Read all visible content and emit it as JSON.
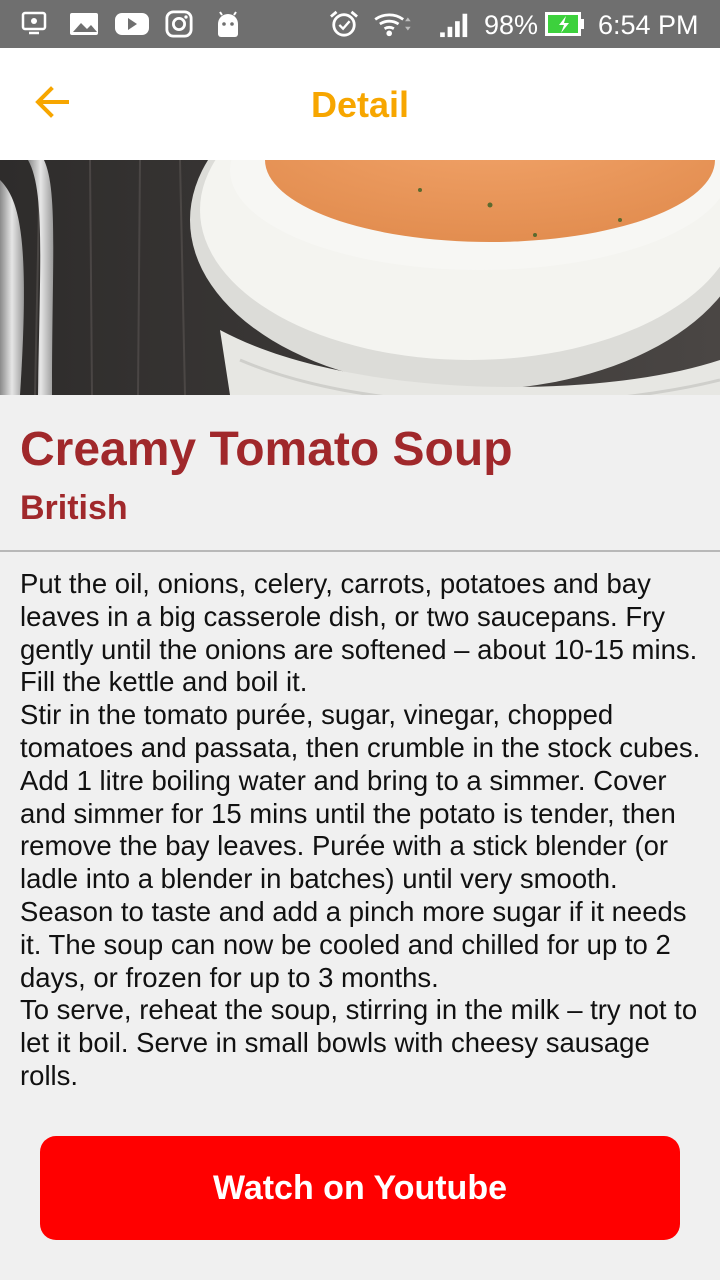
{
  "status_bar": {
    "battery": "98%",
    "time": "6:54 PM"
  },
  "app_bar": {
    "title": "Detail",
    "back_icon": "arrow-back-icon"
  },
  "recipe": {
    "name": "Creamy Tomato Soup",
    "area": "British",
    "instructions": "Put the oil, onions, celery, carrots, potatoes and bay leaves in a big casserole dish, or two saucepans. Fry gently until the onions are softened – about 10-15 mins. Fill the kettle and boil it.\nStir in the tomato purée, sugar, vinegar, chopped tomatoes and passata, then crumble in the stock cubes. Add 1 litre boiling water and bring to a simmer. Cover and simmer for 15 mins until the potato is tender, then remove the bay leaves. Purée with a stick blender (or ladle into a blender in batches) until very smooth. Season to taste and add a pinch more sugar if it needs it. The soup can now be cooled and chilled for up to 2 days, or frozen for up to 3 months.\nTo serve, reheat the soup, stirring in the milk – try not to let it boil. Serve in small bowls with cheesy sausage rolls."
  },
  "actions": {
    "youtube_label": "Watch on Youtube"
  },
  "colors": {
    "accent": "#f7a600",
    "title_red": "#a0282b",
    "youtube_red": "#ff0000"
  }
}
